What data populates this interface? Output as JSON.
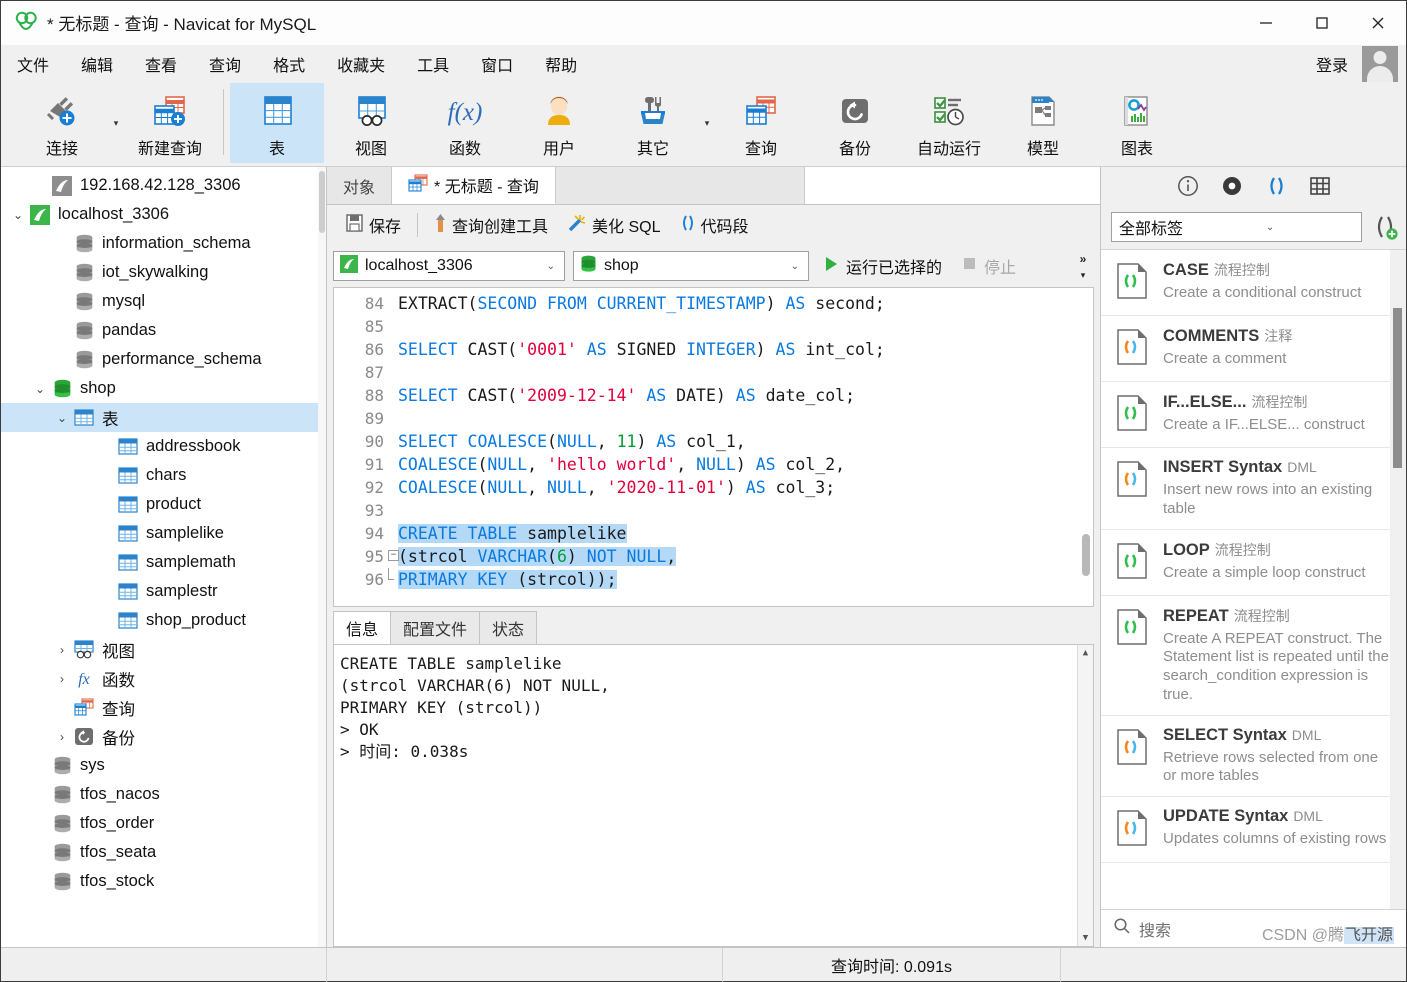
{
  "window": {
    "title": "* 无标题 - 查询 - Navicat for MySQL",
    "minimize": "—",
    "maximize": "□",
    "close": "✕"
  },
  "menubar": {
    "items": [
      "文件",
      "编辑",
      "查看",
      "查询",
      "格式",
      "收藏夹",
      "工具",
      "窗口",
      "帮助"
    ],
    "login_label": "登录"
  },
  "ribbon": {
    "items": [
      {
        "label": "连接",
        "icon": "connection-plus-icon",
        "selected": false,
        "caret": true
      },
      {
        "label": "新建查询",
        "icon": "new-query-icon",
        "selected": false,
        "caret": false
      },
      {
        "label": "表",
        "icon": "table-icon",
        "selected": true,
        "caret": false
      },
      {
        "label": "视图",
        "icon": "view-icon",
        "selected": false,
        "caret": false
      },
      {
        "label": "函数",
        "icon": "function-fx-icon",
        "selected": false,
        "caret": false
      },
      {
        "label": "用户",
        "icon": "user-icon",
        "selected": false,
        "caret": false
      },
      {
        "label": "其它",
        "icon": "other-tools-icon",
        "selected": false,
        "caret": true
      },
      {
        "label": "查询",
        "icon": "query-icon",
        "selected": false,
        "caret": false
      },
      {
        "label": "备份",
        "icon": "backup-icon",
        "selected": false,
        "caret": false
      },
      {
        "label": "自动运行",
        "icon": "automation-icon",
        "selected": false,
        "caret": false
      },
      {
        "label": "模型",
        "icon": "model-icon",
        "selected": false,
        "caret": false
      },
      {
        "label": "图表",
        "icon": "chart-icon",
        "selected": false,
        "caret": false
      }
    ]
  },
  "sidebar": {
    "items": [
      {
        "label": "192.168.42.128_3306",
        "indent": 1,
        "twist": "",
        "icon": "connection-gray-icon",
        "selected": false
      },
      {
        "label": "localhost_3306",
        "indent": 0,
        "twist": "⌄",
        "icon": "connection-green-icon",
        "selected": false
      },
      {
        "label": "information_schema",
        "indent": 2,
        "twist": "",
        "icon": "database-gray-icon",
        "selected": false
      },
      {
        "label": "iot_skywalking",
        "indent": 2,
        "twist": "",
        "icon": "database-gray-icon",
        "selected": false
      },
      {
        "label": "mysql",
        "indent": 2,
        "twist": "",
        "icon": "database-gray-icon",
        "selected": false
      },
      {
        "label": "pandas",
        "indent": 2,
        "twist": "",
        "icon": "database-gray-icon",
        "selected": false
      },
      {
        "label": "performance_schema",
        "indent": 2,
        "twist": "",
        "icon": "database-gray-icon",
        "selected": false
      },
      {
        "label": "shop",
        "indent": 1,
        "twist": "⌄",
        "icon": "database-green-icon",
        "selected": false
      },
      {
        "label": "表",
        "indent": 2,
        "twist": "⌄",
        "icon": "table-folder-icon",
        "selected": true
      },
      {
        "label": "addressbook",
        "indent": 4,
        "twist": "",
        "icon": "table-icon",
        "selected": false
      },
      {
        "label": "chars",
        "indent": 4,
        "twist": "",
        "icon": "table-icon",
        "selected": false
      },
      {
        "label": "product",
        "indent": 4,
        "twist": "",
        "icon": "table-icon",
        "selected": false
      },
      {
        "label": "samplelike",
        "indent": 4,
        "twist": "",
        "icon": "table-icon",
        "selected": false
      },
      {
        "label": "samplemath",
        "indent": 4,
        "twist": "",
        "icon": "table-icon",
        "selected": false
      },
      {
        "label": "samplestr",
        "indent": 4,
        "twist": "",
        "icon": "table-icon",
        "selected": false
      },
      {
        "label": "shop_product",
        "indent": 4,
        "twist": "",
        "icon": "table-icon",
        "selected": false
      },
      {
        "label": "视图",
        "indent": 2,
        "twist": "›",
        "icon": "view-icon",
        "selected": false
      },
      {
        "label": "函数",
        "indent": 2,
        "twist": "›",
        "icon": "function-fx-icon",
        "selected": false
      },
      {
        "label": "查询",
        "indent": 2,
        "twist": "",
        "icon": "query-icon",
        "selected": false
      },
      {
        "label": "备份",
        "indent": 2,
        "twist": "›",
        "icon": "backup-icon",
        "selected": false
      },
      {
        "label": "sys",
        "indent": 1,
        "twist": "",
        "icon": "database-gray-icon",
        "selected": false
      },
      {
        "label": "tfos_nacos",
        "indent": 1,
        "twist": "",
        "icon": "database-gray-icon",
        "selected": false
      },
      {
        "label": "tfos_order",
        "indent": 1,
        "twist": "",
        "icon": "database-gray-icon",
        "selected": false
      },
      {
        "label": "tfos_seata",
        "indent": 1,
        "twist": "",
        "icon": "database-gray-icon",
        "selected": false
      },
      {
        "label": "tfos_stock",
        "indent": 1,
        "twist": "",
        "icon": "database-gray-icon",
        "selected": false
      }
    ]
  },
  "editor": {
    "tabs": [
      {
        "label": "对象",
        "active": false,
        "icon": ""
      },
      {
        "label": "* 无标题 - 查询",
        "active": true,
        "icon": "query-icon"
      }
    ],
    "toolbar": {
      "save": "保存",
      "query_builder": "查询创建工具",
      "beautify_sql": "美化 SQL",
      "snippets": "代码段"
    },
    "connection_value": "localhost_3306",
    "database_value": "shop",
    "run_selected": "运行已选择的",
    "stop": "停止",
    "expand_more": "»",
    "first_line_number": 84,
    "lines": [
      {
        "n": 84,
        "tokens": [
          [
            "pl",
            "EXTRACT("
          ],
          [
            "kw",
            "SECOND FROM CURRENT_TIMESTAMP"
          ],
          [
            "pl",
            ") "
          ],
          [
            "kw",
            "AS"
          ],
          [
            "pl",
            " second;"
          ]
        ]
      },
      {
        "n": 85,
        "tokens": []
      },
      {
        "n": 86,
        "tokens": [
          [
            "kw",
            "SELECT"
          ],
          [
            "pl",
            " CAST("
          ],
          [
            "str",
            "'0001'"
          ],
          [
            "pl",
            " "
          ],
          [
            "kw",
            "AS"
          ],
          [
            "pl",
            " SIGNED "
          ],
          [
            "kw",
            "INTEGER"
          ],
          [
            "pl",
            ") "
          ],
          [
            "kw",
            "AS"
          ],
          [
            "pl",
            " int_col;"
          ]
        ]
      },
      {
        "n": 87,
        "tokens": []
      },
      {
        "n": 88,
        "tokens": [
          [
            "kw",
            "SELECT"
          ],
          [
            "pl",
            " CAST("
          ],
          [
            "str",
            "'2009-12-14'"
          ],
          [
            "pl",
            " "
          ],
          [
            "kw",
            "AS"
          ],
          [
            "pl",
            " DATE) "
          ],
          [
            "kw",
            "AS"
          ],
          [
            "pl",
            " date_col;"
          ]
        ]
      },
      {
        "n": 89,
        "tokens": []
      },
      {
        "n": 90,
        "tokens": [
          [
            "kw",
            "SELECT COALESCE"
          ],
          [
            "pl",
            "("
          ],
          [
            "kw",
            "NULL"
          ],
          [
            "pl",
            ", "
          ],
          [
            "num",
            "11"
          ],
          [
            "pl",
            ") "
          ],
          [
            "kw",
            "AS"
          ],
          [
            "pl",
            " col_1,"
          ]
        ]
      },
      {
        "n": 91,
        "tokens": [
          [
            "kw",
            "COALESCE"
          ],
          [
            "pl",
            "("
          ],
          [
            "kw",
            "NULL"
          ],
          [
            "pl",
            ", "
          ],
          [
            "str",
            "'hello world'"
          ],
          [
            "pl",
            ", "
          ],
          [
            "kw",
            "NULL"
          ],
          [
            "pl",
            ") "
          ],
          [
            "kw",
            "AS"
          ],
          [
            "pl",
            " col_2,"
          ]
        ]
      },
      {
        "n": 92,
        "tokens": [
          [
            "kw",
            "COALESCE"
          ],
          [
            "pl",
            "("
          ],
          [
            "kw",
            "NULL"
          ],
          [
            "pl",
            ", "
          ],
          [
            "kw",
            "NULL"
          ],
          [
            "pl",
            ", "
          ],
          [
            "str",
            "'2020-11-01'"
          ],
          [
            "pl",
            ") "
          ],
          [
            "kw",
            "AS"
          ],
          [
            "pl",
            " col_3;"
          ]
        ]
      },
      {
        "n": 93,
        "tokens": []
      },
      {
        "n": 94,
        "selected": true,
        "tokens": [
          [
            "kw",
            "CREATE TABLE"
          ],
          [
            "pl",
            " samplelike"
          ]
        ]
      },
      {
        "n": 95,
        "selected": true,
        "fold": "−",
        "tokens": [
          [
            "pl",
            "(strcol "
          ],
          [
            "kw",
            "VARCHAR"
          ],
          [
            "pl",
            "("
          ],
          [
            "num",
            "6"
          ],
          [
            "pl",
            ") "
          ],
          [
            "kw",
            "NOT NULL"
          ],
          [
            "pl",
            ","
          ]
        ]
      },
      {
        "n": 96,
        "selected": true,
        "foldend": true,
        "tokens": [
          [
            "kw",
            "PRIMARY KEY"
          ],
          [
            "pl",
            " (strcol));"
          ]
        ]
      }
    ]
  },
  "results": {
    "tabs": [
      {
        "label": "信息",
        "active": true
      },
      {
        "label": "配置文件",
        "active": false
      },
      {
        "label": "状态",
        "active": false
      }
    ],
    "output_lines": [
      "CREATE TABLE samplelike",
      "(strcol VARCHAR(6) NOT NULL,",
      "PRIMARY KEY (strcol))",
      "> OK",
      "> 时间: 0.038s"
    ]
  },
  "snippet_panel": {
    "icons": [
      "info-icon",
      "eye-icon",
      "parentheses-icon",
      "grid-icon"
    ],
    "filter_value": "全部标签",
    "add_label": "add-snippet-icon",
    "search_placeholder": "搜索",
    "snippets": [
      {
        "title": "CASE",
        "tag": "流程控制",
        "desc": "Create a conditional construct",
        "color": "green"
      },
      {
        "title": "COMMENTS",
        "tag": "注释",
        "desc": "Create a comment",
        "color": "multi"
      },
      {
        "title": "IF...ELSE...",
        "tag": "流程控制",
        "desc": "Create a IF...ELSE... construct",
        "color": "green"
      },
      {
        "title": "INSERT Syntax",
        "tag": "DML",
        "desc": "Insert new rows into an existing table",
        "color": "multi"
      },
      {
        "title": "LOOP",
        "tag": "流程控制",
        "desc": "Create a simple loop construct",
        "color": "green"
      },
      {
        "title": "REPEAT",
        "tag": "流程控制",
        "desc": "Create A REPEAT construct. The Statement list is repeated until the search_condition expression is true.",
        "color": "green"
      },
      {
        "title": "SELECT Syntax",
        "tag": "DML",
        "desc": "Retrieve rows selected from one or more tables",
        "color": "multi"
      },
      {
        "title": "UPDATE Syntax",
        "tag": "DML",
        "desc": "Updates columns of existing rows",
        "color": "multi"
      }
    ]
  },
  "statusbar": {
    "query_time": "查询时间: 0.091s"
  },
  "watermark": {
    "prefix": "CSDN @腾",
    "boxed": "飞开源"
  },
  "colors": {
    "accent_blue": "#1a7fd4",
    "selection_blue": "#cce4f7",
    "code_keyword": "#0a7ae0",
    "code_string": "#e0003c",
    "code_number": "#00a030",
    "green_icon": "#2bb24c",
    "orange_icon": "#e2674a"
  }
}
